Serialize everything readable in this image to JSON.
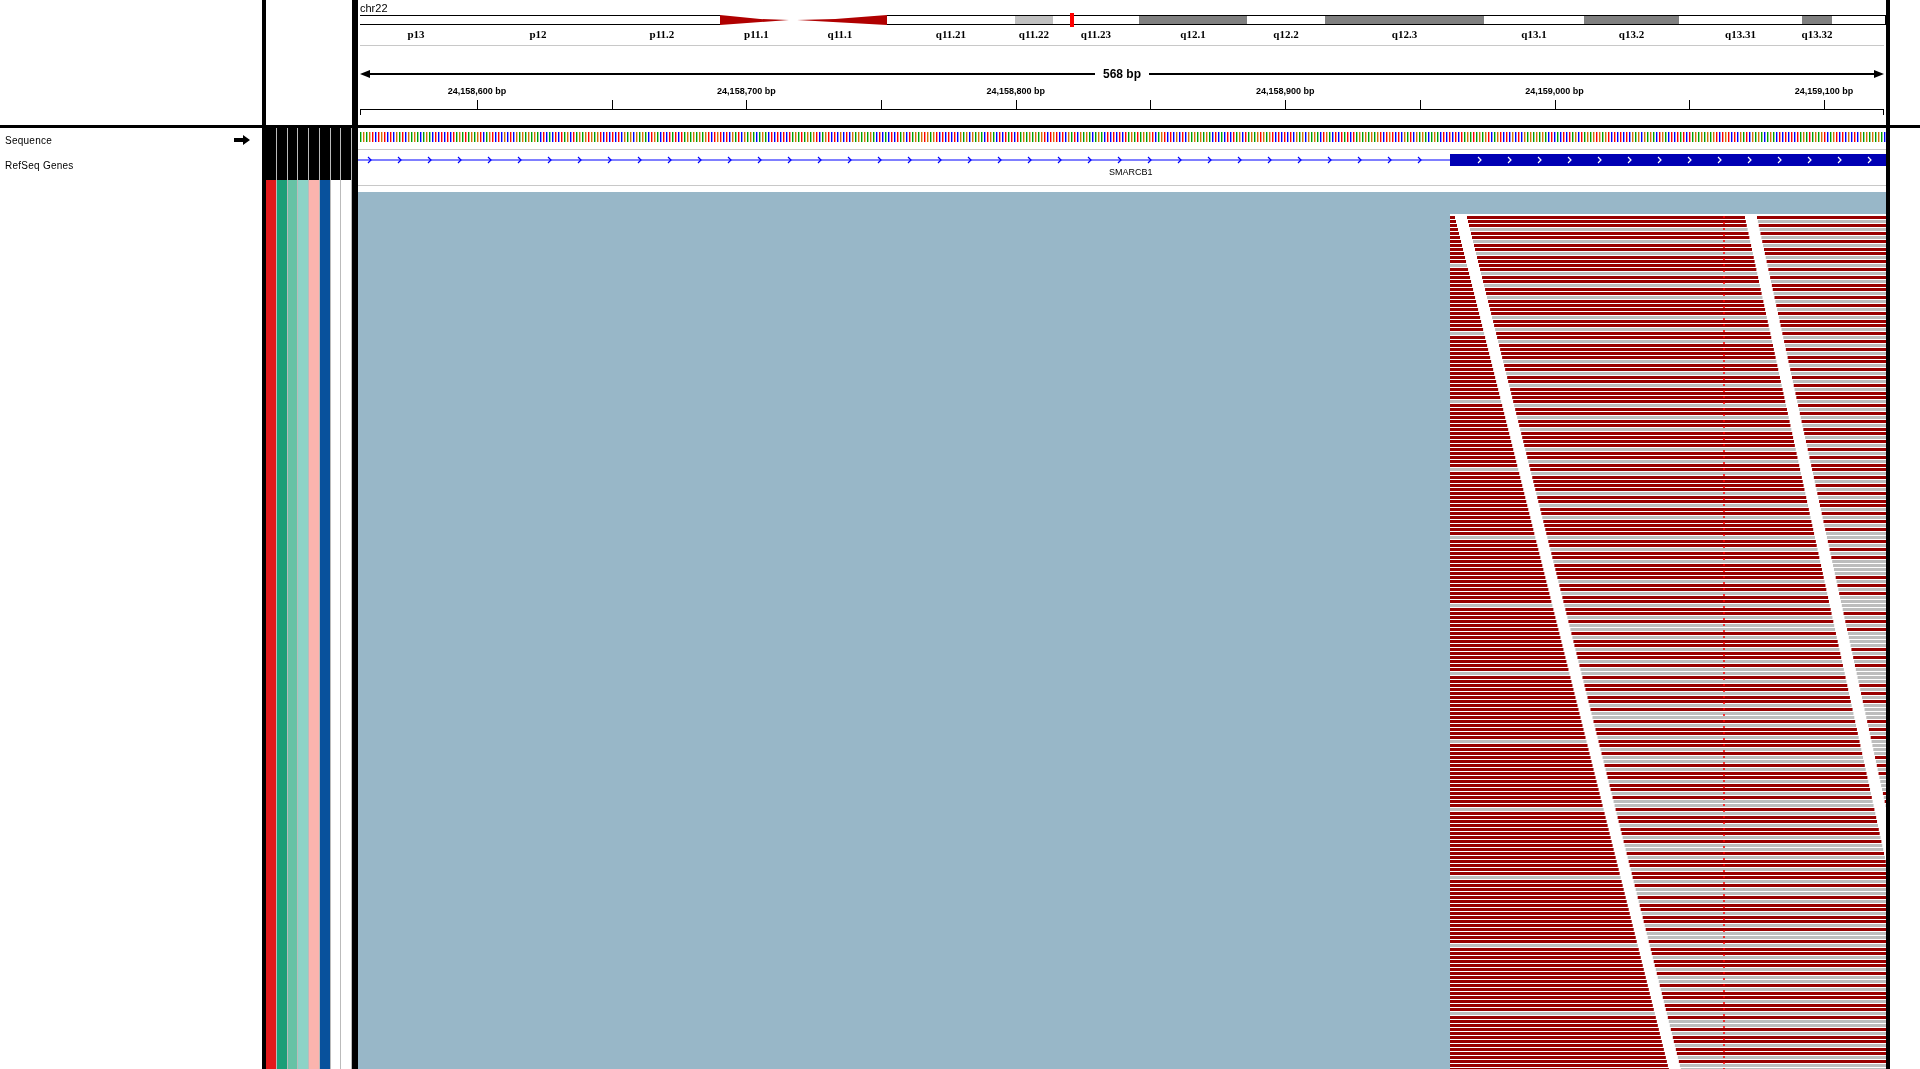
{
  "chromosome": "chr22",
  "ideogram": {
    "bands": [
      {
        "label": "p13",
        "kind": "white"
      },
      {
        "label": "p12",
        "kind": "white"
      },
      {
        "label": "p11.2",
        "kind": "white"
      },
      {
        "label": "p11.1",
        "kind": "centromere_p"
      },
      {
        "label": "q11.1",
        "kind": "centromere_q"
      },
      {
        "label": "q11.21",
        "kind": "white"
      },
      {
        "label": "q11.22",
        "kind": "light"
      },
      {
        "label": "q11.23",
        "kind": "white"
      },
      {
        "label": "q12.1",
        "kind": "dark"
      },
      {
        "label": "q12.2",
        "kind": "white"
      },
      {
        "label": "q12.3",
        "kind": "dark"
      },
      {
        "label": "q13.1",
        "kind": "white"
      },
      {
        "label": "q13.2",
        "kind": "dark"
      },
      {
        "label": "q13.31",
        "kind": "white"
      },
      {
        "label": "q13.32",
        "kind": "dark"
      }
    ]
  },
  "ruler": {
    "span": "568 bp",
    "ticks": [
      "24,158,600 bp",
      "24,158,700 bp",
      "24,158,800 bp",
      "24,158,900 bp",
      "24,159,000 bp",
      "24,159,100 bp"
    ]
  },
  "tracks": [
    {
      "name": "Sequence",
      "kind": "sequence"
    },
    {
      "name": "RefSeq Genes",
      "kind": "genes",
      "gene": "SMARCB1"
    }
  ],
  "attributes": [
    {
      "color": "#e41a1c"
    },
    {
      "color": "#1b9e77"
    },
    {
      "color": "#66c2a5"
    },
    {
      "color": "#8dd3c7"
    },
    {
      "color": "#fbb4ae"
    },
    {
      "color": "#08519c"
    },
    {
      "color": "#ffffff"
    },
    {
      "color": "#ffffff"
    }
  ]
}
